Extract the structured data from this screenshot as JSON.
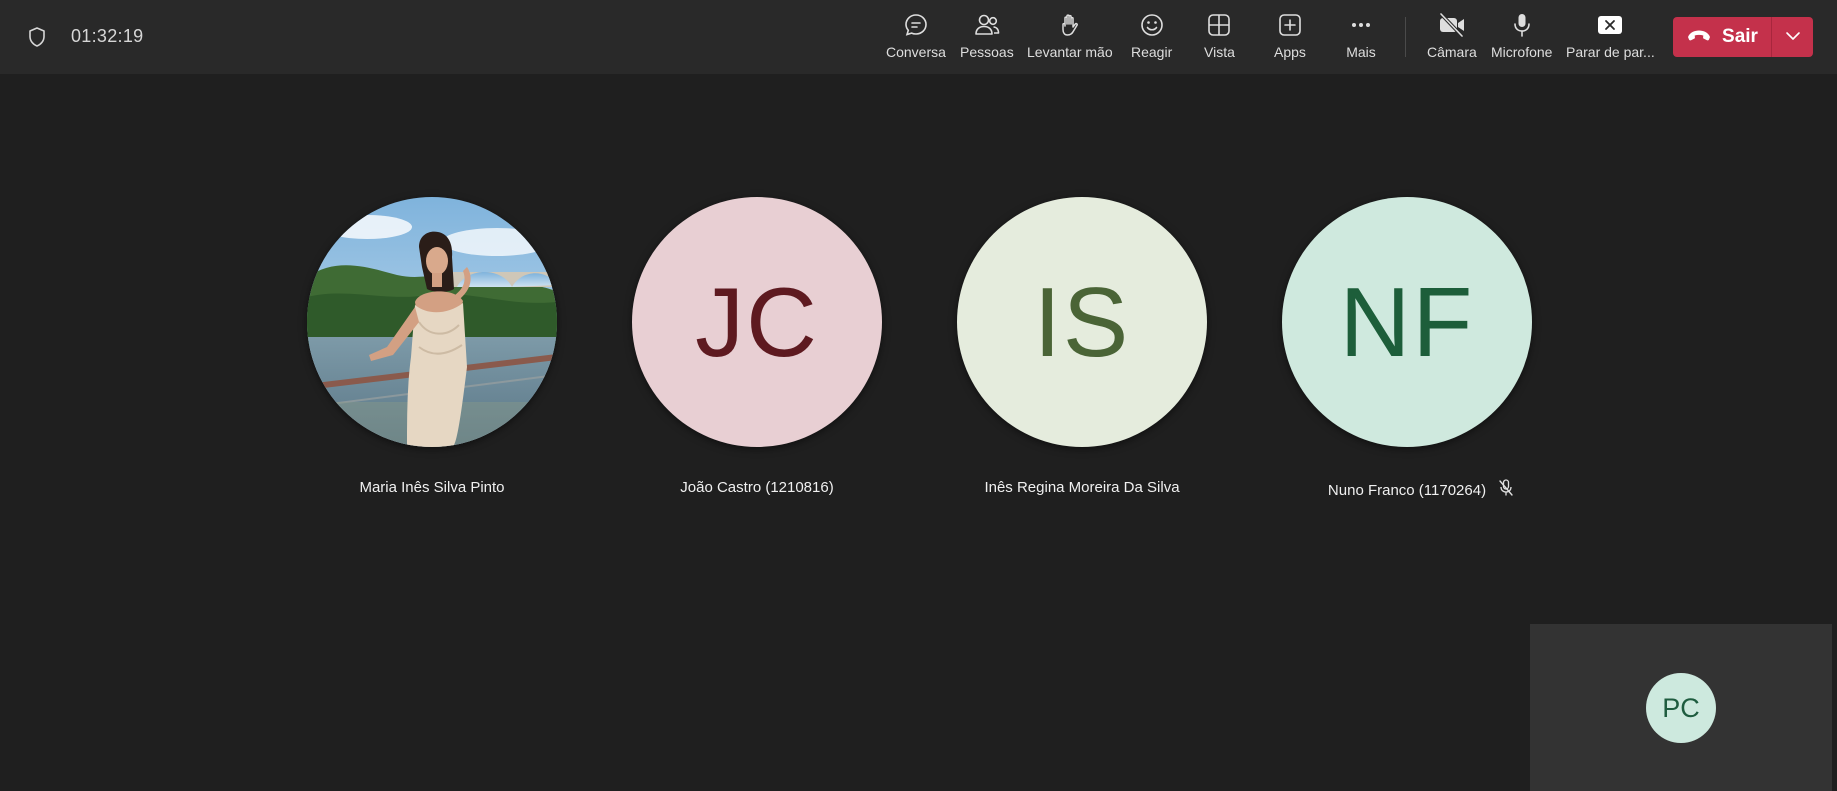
{
  "header": {
    "timer": "01:32:19",
    "toolbar": {
      "chat": "Conversa",
      "people": "Pessoas",
      "raise_hand": "Levantar mão",
      "react": "Reagir",
      "view": "Vista",
      "apps": "Apps",
      "more": "Mais",
      "camera": "Câmara",
      "microphone": "Microfone",
      "stop_sharing": "Parar de par..."
    },
    "leave_label": "Sair"
  },
  "participants": [
    {
      "name": "Maria Inês Silva Pinto",
      "initials": "",
      "avatar_bg": "#6aa2c9",
      "initials_color": ""
    },
    {
      "name": "João Castro (1210816)",
      "initials": "JC",
      "avatar_bg": "#e8cfd3",
      "initials_color": "#5e1a20"
    },
    {
      "name": "Inês Regina Moreira Da Silva",
      "initials": "IS",
      "avatar_bg": "#e5ecdd",
      "initials_color": "#4a6436"
    },
    {
      "name": "Nuno Franco (1170264)",
      "initials": "NF",
      "avatar_bg": "#cfe9de",
      "initials_color": "#1d5e3a",
      "muted": true
    }
  ],
  "self_view": {
    "initials": "PC"
  },
  "colors": {
    "leave_button": "#c4314b",
    "topbar": "#292929",
    "stage": "#1f1f1f"
  }
}
